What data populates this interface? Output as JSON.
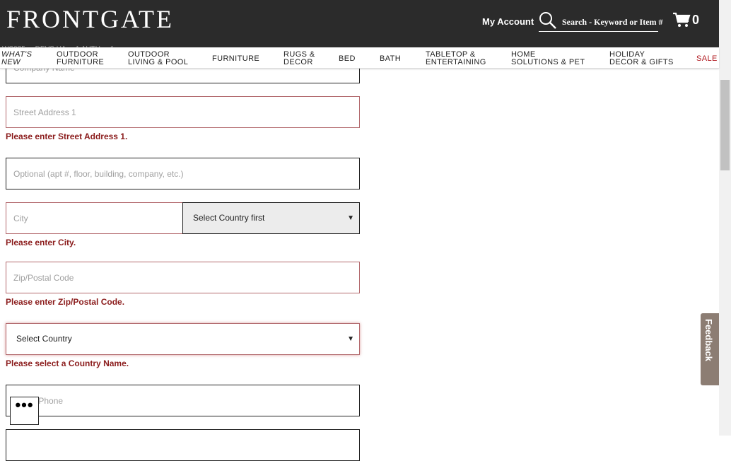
{
  "header": {
    "logo": "FRONTGATE",
    "my_account": "My Account",
    "search_placeholder": "Search - Keyword or Item #",
    "cart_count": "0"
  },
  "behind_nav_text": "WS0?5 ... DEVS  HA ... 1  AUTH ... 1",
  "nav": [
    "WHAT'S\nNEW",
    "OUTDOOR\nFURNITURE",
    "OUTDOOR\nLIVING & POOL",
    "FURNITURE",
    "RUGS &\nDECOR",
    "BED",
    "BATH",
    "TABLETOP &\nENTERTAINING",
    "HOME\nSOLUTIONS & PET",
    "HOLIDAY\nDECOR & GIFTS",
    "SALE"
  ],
  "form": {
    "company_placeholder": "Company Name",
    "street1_placeholder": "Street Address 1",
    "street1_error": "Please enter Street Address 1.",
    "street2_placeholder": "Optional (apt #, floor, building, company, etc.)",
    "city_placeholder": "City",
    "state_select": "Select Country first",
    "city_error": "Please enter City.",
    "zip_placeholder": "Zip/Postal Code",
    "zip_error": "Please enter Zip/Postal Code.",
    "country_select": "Select Country",
    "country_error": "Please select a Country Name.",
    "phone_placeholder": "Home Phone"
  },
  "more_button": "•••",
  "feedback_tab": "Feedback",
  "colors": {
    "header_bg": "#2b2b2b",
    "error_text": "#8b1c1c",
    "sale": "#b0181e",
    "feedback_bg": "#8c7d73"
  }
}
